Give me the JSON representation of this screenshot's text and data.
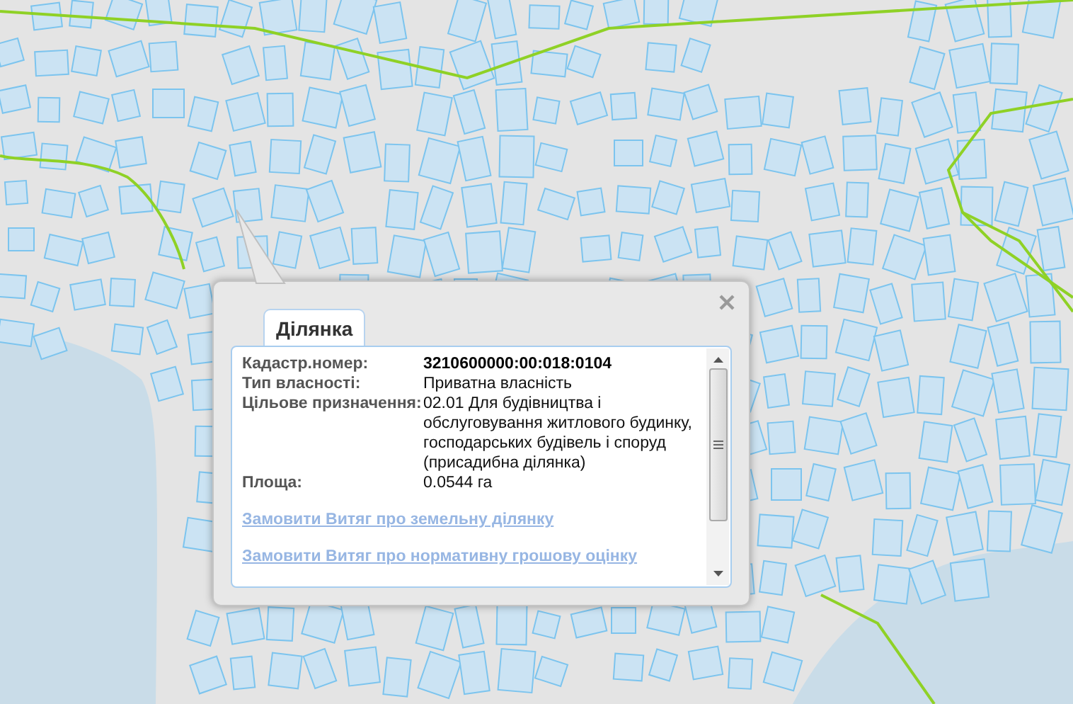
{
  "popup": {
    "tab": {
      "label": "Ділянка",
      "selected": true
    },
    "fields": [
      {
        "label": "Кадастр.номер:",
        "value": "3210600000:00:018:0104",
        "bold": true
      },
      {
        "label": "Тип власності:",
        "value": "Приватна власність",
        "bold": false
      },
      {
        "label": "Цільове призначення:",
        "value": "02.01 Для будівництва і обслуговування житлового будинку, господарських будівель і споруд (присадибна ділянка)",
        "bold": false
      },
      {
        "label": "Площа:",
        "value": "0.0544 га",
        "bold": false
      }
    ],
    "links": [
      "Замовити Витяг про земельну ділянку",
      "Замовити Витяг про нормативну грошову оцінку"
    ]
  }
}
